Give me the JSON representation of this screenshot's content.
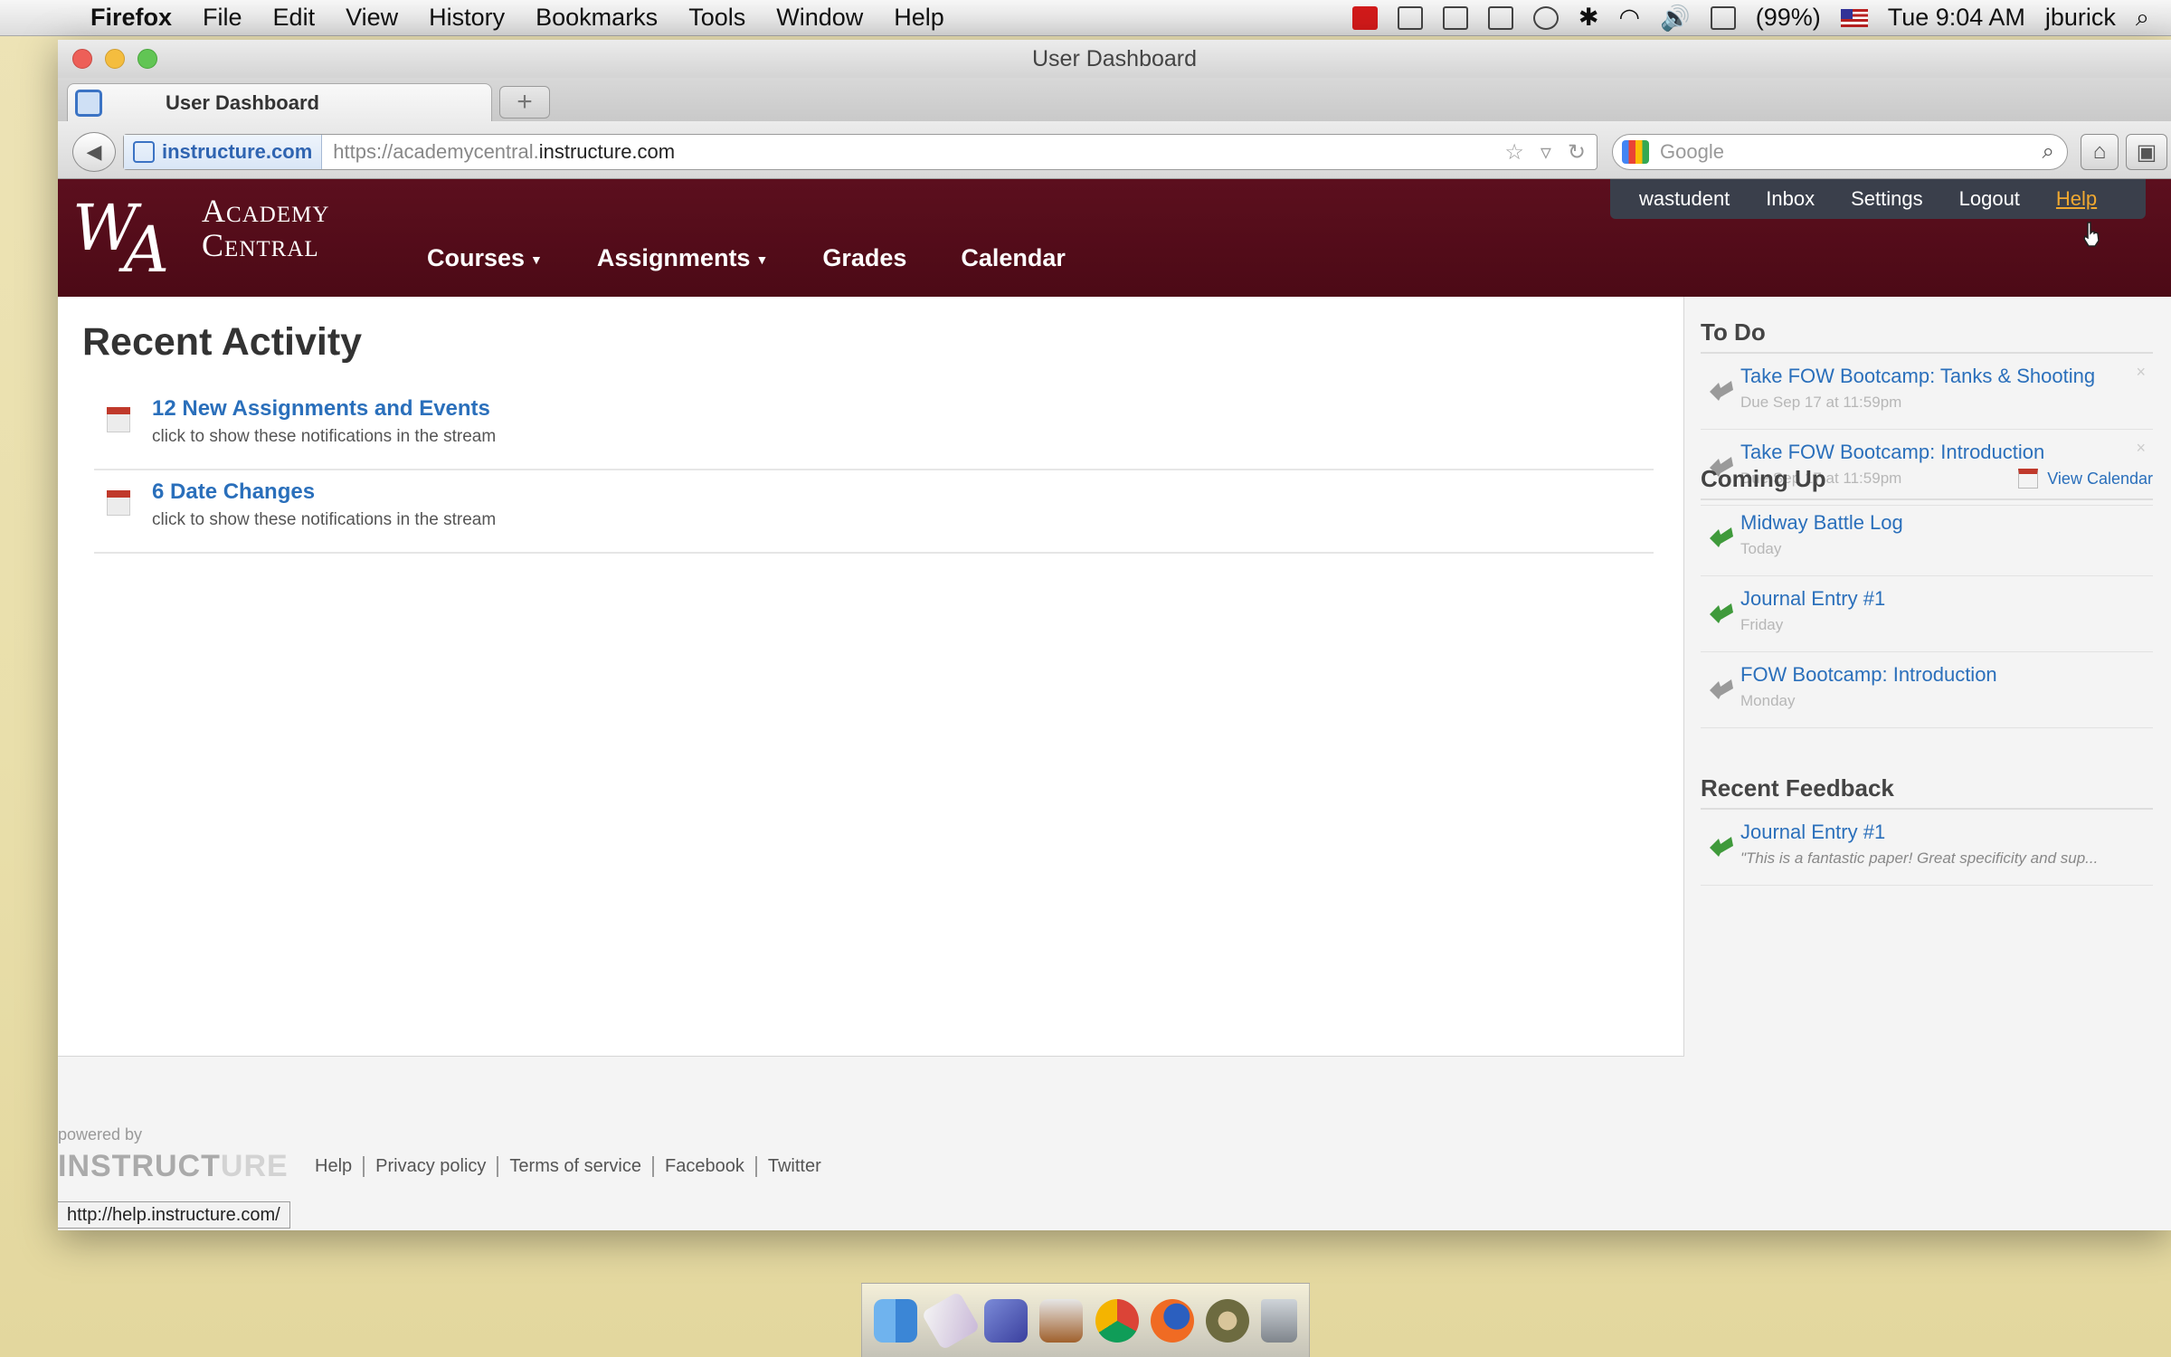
{
  "menubar": {
    "app_name": "Firefox",
    "items": [
      "File",
      "Edit",
      "View",
      "History",
      "Bookmarks",
      "Tools",
      "Window",
      "Help"
    ],
    "battery": "(99%)",
    "clock": "Tue 9:04 AM",
    "user": "jburick"
  },
  "browser": {
    "window_title": "User Dashboard",
    "tab_title": "User Dashboard",
    "site_identity": "instructure.com",
    "url_prefix": "https://academycentral.",
    "url_domain": "instructure.com",
    "search_placeholder": "Google",
    "status_url": "http://help.instructure.com/"
  },
  "header": {
    "logo_line1": "Academy",
    "logo_line2": "Central",
    "nav": [
      "Courses",
      "Assignments",
      "Grades",
      "Calendar"
    ],
    "user_menu": [
      "wastudent",
      "Inbox",
      "Settings",
      "Logout",
      "Help"
    ],
    "active_user_menu": "Help",
    "colors": {
      "header_bg": "#5c0f1e",
      "user_menu_bg": "#3a3f4b",
      "link": "#2a6fbb",
      "active_link": "#f0a830"
    }
  },
  "main": {
    "title": "Recent Activity",
    "activity": [
      {
        "title": "12 New Assignments and Events",
        "sub": "click to show these notifications in the stream"
      },
      {
        "title": "6 Date Changes",
        "sub": "click to show these notifications in the stream"
      }
    ]
  },
  "sidebar": {
    "todo_heading": "To Do",
    "todo": [
      {
        "title": "Take FOW Bootcamp: Tanks & Shooting",
        "sub": "Due Sep 17 at 11:59pm"
      },
      {
        "title": "Take FOW Bootcamp: Introduction",
        "sub": "Due Sep 17 at 11:59pm"
      }
    ],
    "coming_up_heading": "Coming Up",
    "view_calendar": "View Calendar",
    "coming_up": [
      {
        "title": "Midway Battle Log",
        "sub": "Today"
      },
      {
        "title": "Journal Entry #1",
        "sub": "Friday"
      },
      {
        "title": "FOW Bootcamp: Introduction",
        "sub": "Monday"
      }
    ],
    "feedback_heading": "Recent Feedback",
    "feedback": [
      {
        "title": "Journal Entry #1",
        "sub": "\"This is a fantastic paper! Great specificity and sup..."
      }
    ]
  },
  "footer": {
    "powered_by": "powered by",
    "logo_main": "INSTRUCT",
    "logo_faded": "URE",
    "links": [
      "Help",
      "Privacy policy",
      "Terms of service",
      "Facebook",
      "Twitter"
    ]
  }
}
